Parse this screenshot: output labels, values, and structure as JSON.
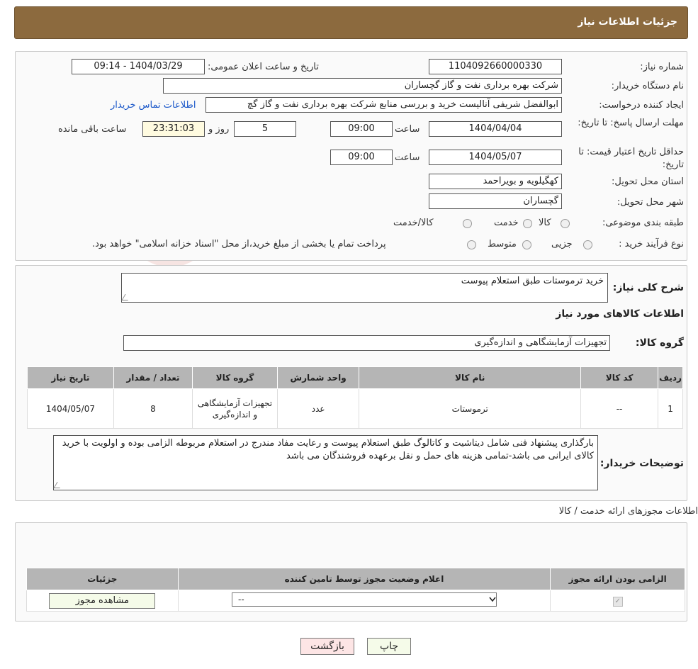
{
  "header": {
    "title": "جزئیات اطلاعات نیاز"
  },
  "form": {
    "need_number_label": "شماره نیاز:",
    "need_number": "1104092660000330",
    "announce_label": "تاریخ و ساعت اعلان عمومی:",
    "announce_value": "1404/03/29 - 09:14",
    "buyer_label": "نام دستگاه خریدار:",
    "buyer_value": "شرکت بهره برداری نفت و گاز گچساران",
    "creator_label": "ایجاد کننده درخواست:",
    "creator_value": "ابوالفضل شریفی آنالیست خرید و بررسی منابع شرکت بهره برداری نفت و گاز گچ",
    "contact_link": "اطلاعات تماس خریدار",
    "deadline_label": "مهلت ارسال پاسخ: تا تاریخ:",
    "deadline_date": "1404/04/04",
    "time_label": "ساعت",
    "deadline_time": "09:00",
    "days_value": "5",
    "days_label": "روز و",
    "remaining_value": "23:31:03",
    "remaining_label": "ساعت باقی مانده",
    "validity_label": "حداقل تاریخ اعتبار قیمت: تا تاریخ:",
    "validity_date": "1404/05/07",
    "validity_time": "09:00",
    "province_label": "استان محل تحویل:",
    "province_value": "کهگیلویه و بویراحمد",
    "city_label": "شهر محل تحویل:",
    "city_value": "گچساران",
    "category_label": "طبقه بندی موضوعی:",
    "category_options": [
      "کالا",
      "خدمت",
      "کالا/خدمت"
    ],
    "purchase_type_label": "نوع فرآیند خرید :",
    "purchase_type_options": [
      "جزیی",
      "متوسط"
    ],
    "purchase_note": "پرداخت تمام یا بخشی از مبلغ خرید،از محل \"اسناد خزانه اسلامی\" خواهد بود."
  },
  "summary": {
    "desc_label": "شرح کلی نیاز:",
    "desc_value": "خرید ترموستات طبق استعلام پیوست",
    "goods_info_title": "اطلاعات کالاهای مورد نیاز",
    "group_label": "گروه کالا:",
    "group_value": "تجهیزات آزمایشگاهی و اندازه‌گیری",
    "table": {
      "headers": [
        "ردیف",
        "کد کالا",
        "نام کالا",
        "واحد شمارش",
        "گروه کالا",
        "تعداد / مقدار",
        "تاریخ نیاز"
      ],
      "rows": [
        [
          "1",
          "--",
          "ترموستات",
          "عدد",
          "تجهیزات آزمایشگاهی و اندازه‌گیری",
          "8",
          "1404/05/07"
        ]
      ]
    },
    "notes_label": "توضیحات خریدار:",
    "notes_value": "بارگذاری پیشنهاد فنی شامل دیتاشیت و کاتالوگ طبق استعلام پیوست و رعایت مفاد مندرج در استعلام مربوطه الزامی بوده و اولویت با خرید کالای ایرانی می باشد-تمامی هزینه های حمل و نقل برعهده فروشندگان می باشد"
  },
  "permits": {
    "title": "اطلاعات مجوزهای ارائه خدمت / کالا",
    "headers": [
      "الزامی بودن ارائه مجوز",
      "اعلام وضعیت مجوز توسط تامین کننده",
      "جزئیات"
    ],
    "select_value": "--",
    "view_button": "مشاهده مجوز"
  },
  "buttons": {
    "print": "چاپ",
    "back": "بازگشت"
  },
  "watermark": {
    "text": "AriaTender.neT"
  },
  "colors": {
    "header_bg": "#8c6a3e",
    "link": "#1a57c9",
    "table_header": "#b5b5b5",
    "yellow_field": "#fffbe0"
  }
}
